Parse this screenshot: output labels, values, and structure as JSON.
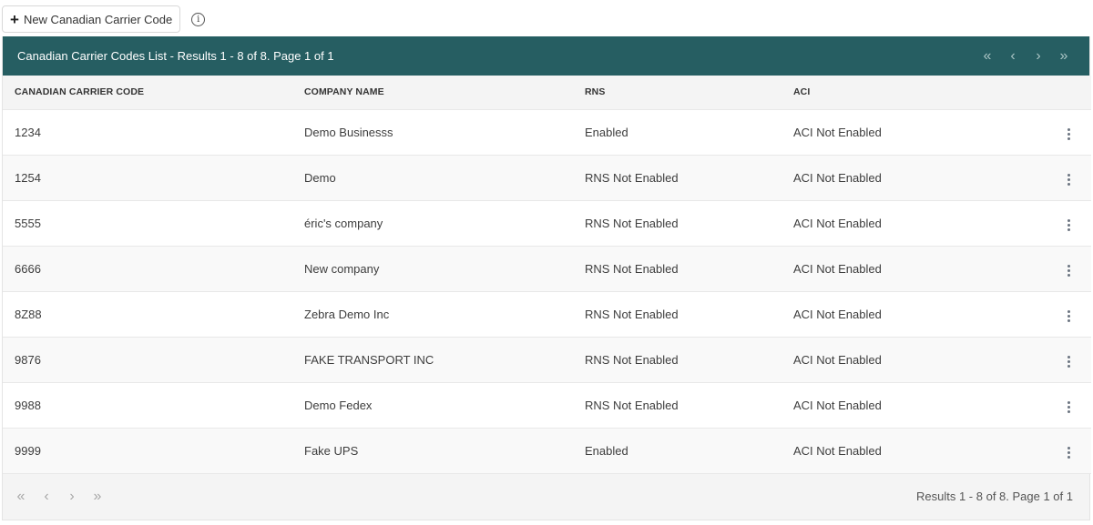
{
  "toolbar": {
    "new_button_label": "New Canadian Carrier Code",
    "new_button_icon": "plus-icon",
    "info_icon": "info-icon"
  },
  "panel": {
    "title": "Canadian Carrier Codes List - Results 1 - 8 of 8. Page 1 of 1",
    "header_color": "#265e62",
    "pager": {
      "first": "«",
      "prev": "‹",
      "next": "›",
      "last": "»"
    }
  },
  "table": {
    "columns": [
      "CANADIAN CARRIER CODE",
      "COMPANY NAME",
      "RNS",
      "ACI"
    ],
    "rows": [
      {
        "code": "1234",
        "company": "Demo Businesss",
        "rns": "Enabled",
        "aci": "ACI Not Enabled"
      },
      {
        "code": "1254",
        "company": "Demo",
        "rns": "RNS Not Enabled",
        "aci": "ACI Not Enabled"
      },
      {
        "code": "5555",
        "company": "éric's company",
        "rns": "RNS Not Enabled",
        "aci": "ACI Not Enabled"
      },
      {
        "code": "6666",
        "company": "New company",
        "rns": "RNS Not Enabled",
        "aci": "ACI Not Enabled"
      },
      {
        "code": "8Z88",
        "company": "Zebra Demo Inc",
        "rns": "RNS Not Enabled",
        "aci": "ACI Not Enabled"
      },
      {
        "code": "9876",
        "company": "FAKE TRANSPORT INC",
        "rns": "RNS Not Enabled",
        "aci": "ACI Not Enabled"
      },
      {
        "code": "9988",
        "company": "Demo Fedex",
        "rns": "RNS Not Enabled",
        "aci": "ACI Not Enabled"
      },
      {
        "code": "9999",
        "company": "Fake UPS",
        "rns": "Enabled",
        "aci": "ACI Not Enabled"
      }
    ]
  },
  "footer": {
    "summary": "Results 1 - 8 of 8. Page 1 of 1",
    "pager": {
      "first": "«",
      "prev": "‹",
      "next": "›",
      "last": "»"
    }
  }
}
